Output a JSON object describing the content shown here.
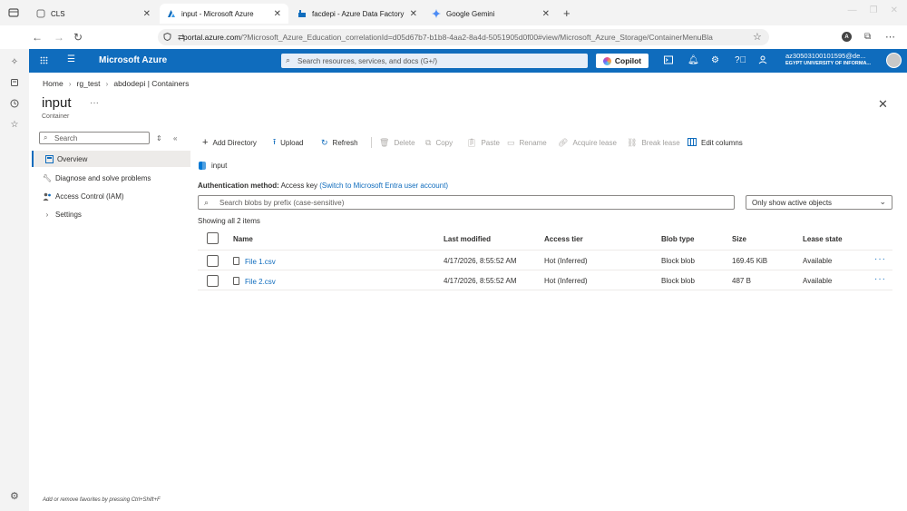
{
  "browser": {
    "tabs": [
      {
        "label": "CLS"
      },
      {
        "label": "input - Microsoft Azure"
      },
      {
        "label": "facdepi - Azure Data Factory"
      },
      {
        "label": "Google Gemini"
      }
    ],
    "url_host": "portal.azure.com",
    "url_rest": "/?Microsoft_Azure_Education_correlationId=d05d67b7-b1b8-4aa2-8a4d-5051905d0f00#view/Microsoft_Azure_Storage/ContainerMenuBla",
    "profile_letter": "A"
  },
  "azure_header": {
    "brand": "Microsoft Azure",
    "search_placeholder": "Search resources, services, and docs (G+/)",
    "copilot_label": "Copilot",
    "account_email": "az30503100101595@de...",
    "account_org": "EGYPT UNIVERSITY OF INFORMA..."
  },
  "breadcrumb": [
    "Home",
    "rg_test",
    "abdodepi | Containers"
  ],
  "page": {
    "title": "input",
    "more": "···",
    "subtitle": "Container"
  },
  "blade_menu": {
    "search_placeholder": "Search",
    "items": [
      {
        "label": "Overview"
      },
      {
        "label": "Diagnose and solve problems"
      },
      {
        "label": "Access Control (IAM)"
      },
      {
        "label": "Settings"
      }
    ],
    "favorites_hint": "Add or remove favorites by pressing Ctrl+Shift+F"
  },
  "toolbar": {
    "add_directory": "Add Directory",
    "upload": "Upload",
    "refresh": "Refresh",
    "delete": "Delete",
    "copy": "Copy",
    "paste": "Paste",
    "rename": "Rename",
    "acquire_lease": "Acquire lease",
    "break_lease": "Break lease",
    "edit_columns": "Edit columns"
  },
  "content": {
    "path": "input",
    "auth_label": "Authentication method:",
    "auth_value": "Access key",
    "auth_link": "(Switch to Microsoft Entra user account)",
    "blob_search_placeholder": "Search blobs by prefix (case-sensitive)",
    "filter_value": "Only show active objects",
    "showing": "Showing all 2 items"
  },
  "table": {
    "headers": {
      "name": "Name",
      "modified": "Last modified",
      "tier": "Access tier",
      "type": "Blob type",
      "size": "Size",
      "lease": "Lease state"
    },
    "rows": [
      {
        "name": "File 1.csv",
        "modified": "4/17/2026, 8:55:52 AM",
        "tier": "Hot (Inferred)",
        "type": "Block blob",
        "size": "169.45 KiB",
        "lease": "Available",
        "more": "···"
      },
      {
        "name": "File 2.csv",
        "modified": "4/17/2026, 8:55:52 AM",
        "tier": "Hot (Inferred)",
        "type": "Block blob",
        "size": "487 B",
        "lease": "Available",
        "more": "···"
      }
    ]
  },
  "colors": {
    "azure_blue": "#0f6cbd",
    "link": "#0f6cbd"
  }
}
